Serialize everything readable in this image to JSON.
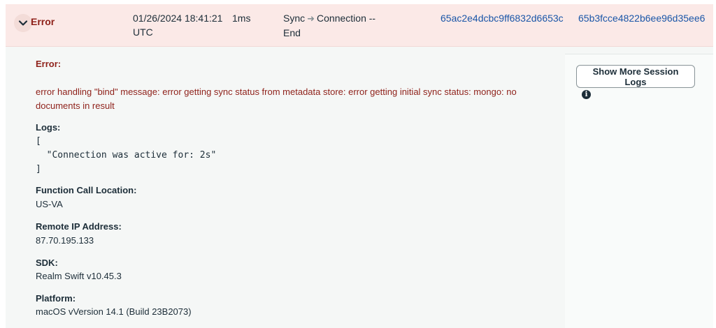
{
  "row": {
    "status": "Error",
    "timestamp": "01/26/2024 18:41:21 UTC",
    "duration": "1ms",
    "type_from": "Sync",
    "type_to": "Connection -- End",
    "request_id": "65ac2e4dcbc9ff6832d6653c",
    "session_id": "65b3fcce4822b6ee96d35ee6"
  },
  "detail": {
    "error_label": "Error:",
    "error_message": "error handling \"bind\" message: error getting sync status from metadata store: error getting initial sync status: mongo: no documents in result",
    "logs_label": "Logs:",
    "logs_text": "[\n  \"Connection was active for: 2s\"\n]",
    "location_label": "Function Call Location:",
    "location_value": "US-VA",
    "ip_label": "Remote IP Address:",
    "ip_value": "87.70.195.133",
    "sdk_label": "SDK:",
    "sdk_value": "Realm Swift v10.45.3",
    "platform_label": "Platform:",
    "platform_value": "macOS vVersion 14.1 (Build 23B2073)",
    "more_logs_button": "Show More Session Logs",
    "info_glyph": "i"
  },
  "icons": {
    "expand": "chevron-down-icon",
    "arrow": "arrow-right-icon",
    "info": "info-icon"
  },
  "colors": {
    "error_text": "#8f221b",
    "header_bg": "#fbe9e7",
    "link": "#1a56a8",
    "detail_bg": "#f5f7f6"
  }
}
